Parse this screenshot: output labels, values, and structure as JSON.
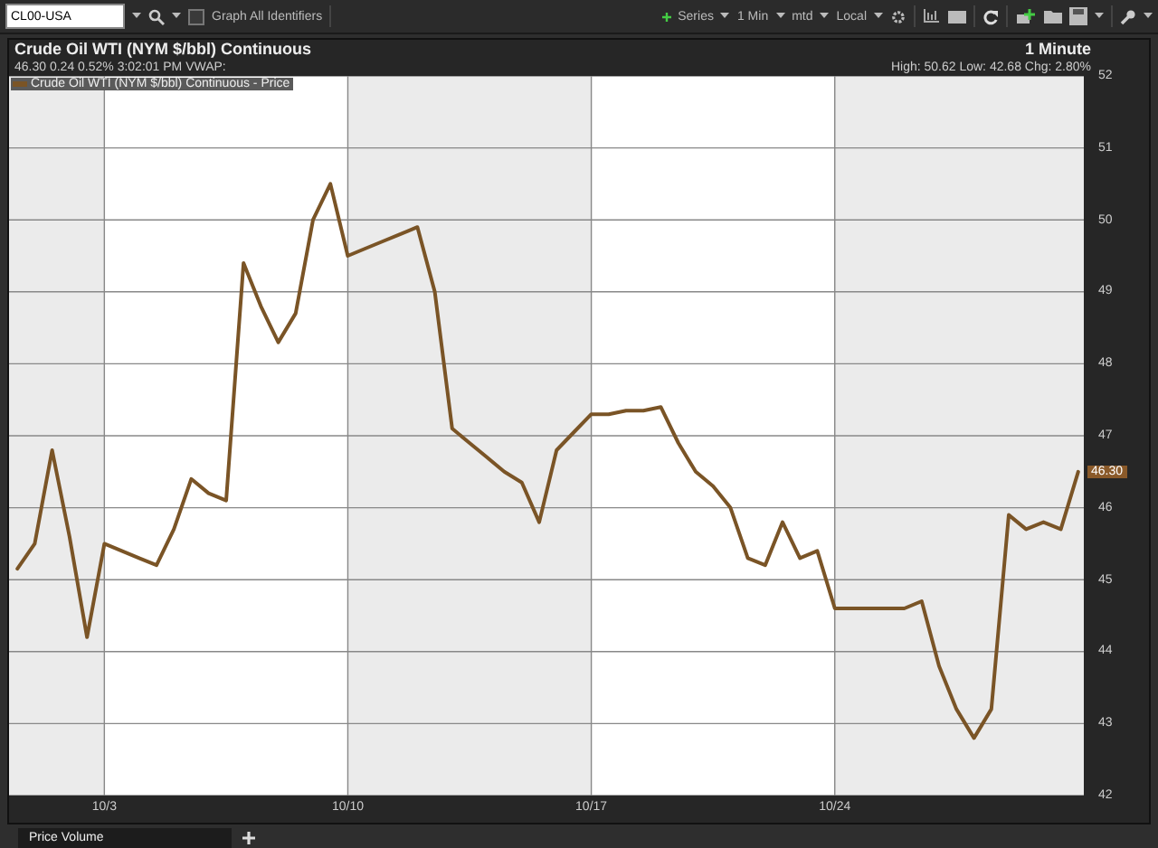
{
  "toolbar": {
    "ticker": "CL00-USA",
    "graph_all": {
      "label": "Graph All Identifiers",
      "checked": false
    },
    "series": "Series",
    "interval": "1 Min",
    "range": "mtd",
    "timezone": "Local"
  },
  "chart_header": {
    "title": "Crude Oil WTI (NYM $/bbl) Continuous",
    "quote": "46.30 0.24 0.52% 3:02:01 PM VWAP:",
    "frequency": "1 Minute",
    "stats": "High: 50.62 Low: 42.68 Chg: 2.80%"
  },
  "last_price": "46.30",
  "chart_data": {
    "type": "line",
    "grid": true,
    "ylim": [
      42,
      52
    ],
    "yticks": [
      42,
      43,
      44,
      45,
      46,
      47,
      48,
      49,
      50,
      51,
      52
    ],
    "categories": [
      null,
      null,
      null,
      null,
      null,
      "10/3",
      null,
      null,
      null,
      null,
      null,
      null,
      null,
      null,
      null,
      null,
      null,
      null,
      null,
      "10/10",
      null,
      null,
      null,
      null,
      null,
      null,
      null,
      null,
      null,
      null,
      null,
      null,
      null,
      "10/17",
      null,
      null,
      null,
      null,
      null,
      null,
      null,
      null,
      null,
      null,
      null,
      null,
      null,
      "10/24",
      null,
      null,
      null,
      null,
      null,
      null,
      null,
      null,
      null,
      null,
      null,
      null,
      null,
      null
    ],
    "series": [
      {
        "name": "Crude Oil WTI (NYM $/bbl) Continuous - Price",
        "color": "#7a5426",
        "values": [
          45.15,
          45.5,
          46.8,
          45.6,
          44.2,
          45.5,
          45.4,
          45.3,
          45.2,
          45.7,
          46.4,
          46.2,
          46.1,
          49.4,
          48.8,
          48.3,
          48.7,
          50.0,
          50.5,
          49.5,
          49.6,
          49.7,
          49.8,
          49.9,
          49.0,
          47.1,
          46.9,
          46.7,
          46.5,
          46.35,
          45.8,
          46.8,
          47.05,
          47.3,
          47.3,
          47.35,
          47.35,
          47.4,
          46.9,
          46.5,
          46.3,
          46.0,
          45.3,
          45.2,
          45.8,
          45.3,
          45.4,
          44.6,
          44.6,
          44.6,
          44.6,
          44.6,
          44.7,
          43.8,
          43.2,
          42.8,
          43.2,
          45.9,
          45.7,
          45.8,
          45.7,
          46.5
        ]
      }
    ]
  },
  "tabs": [
    {
      "label": "Price Volume",
      "selected": true
    }
  ]
}
